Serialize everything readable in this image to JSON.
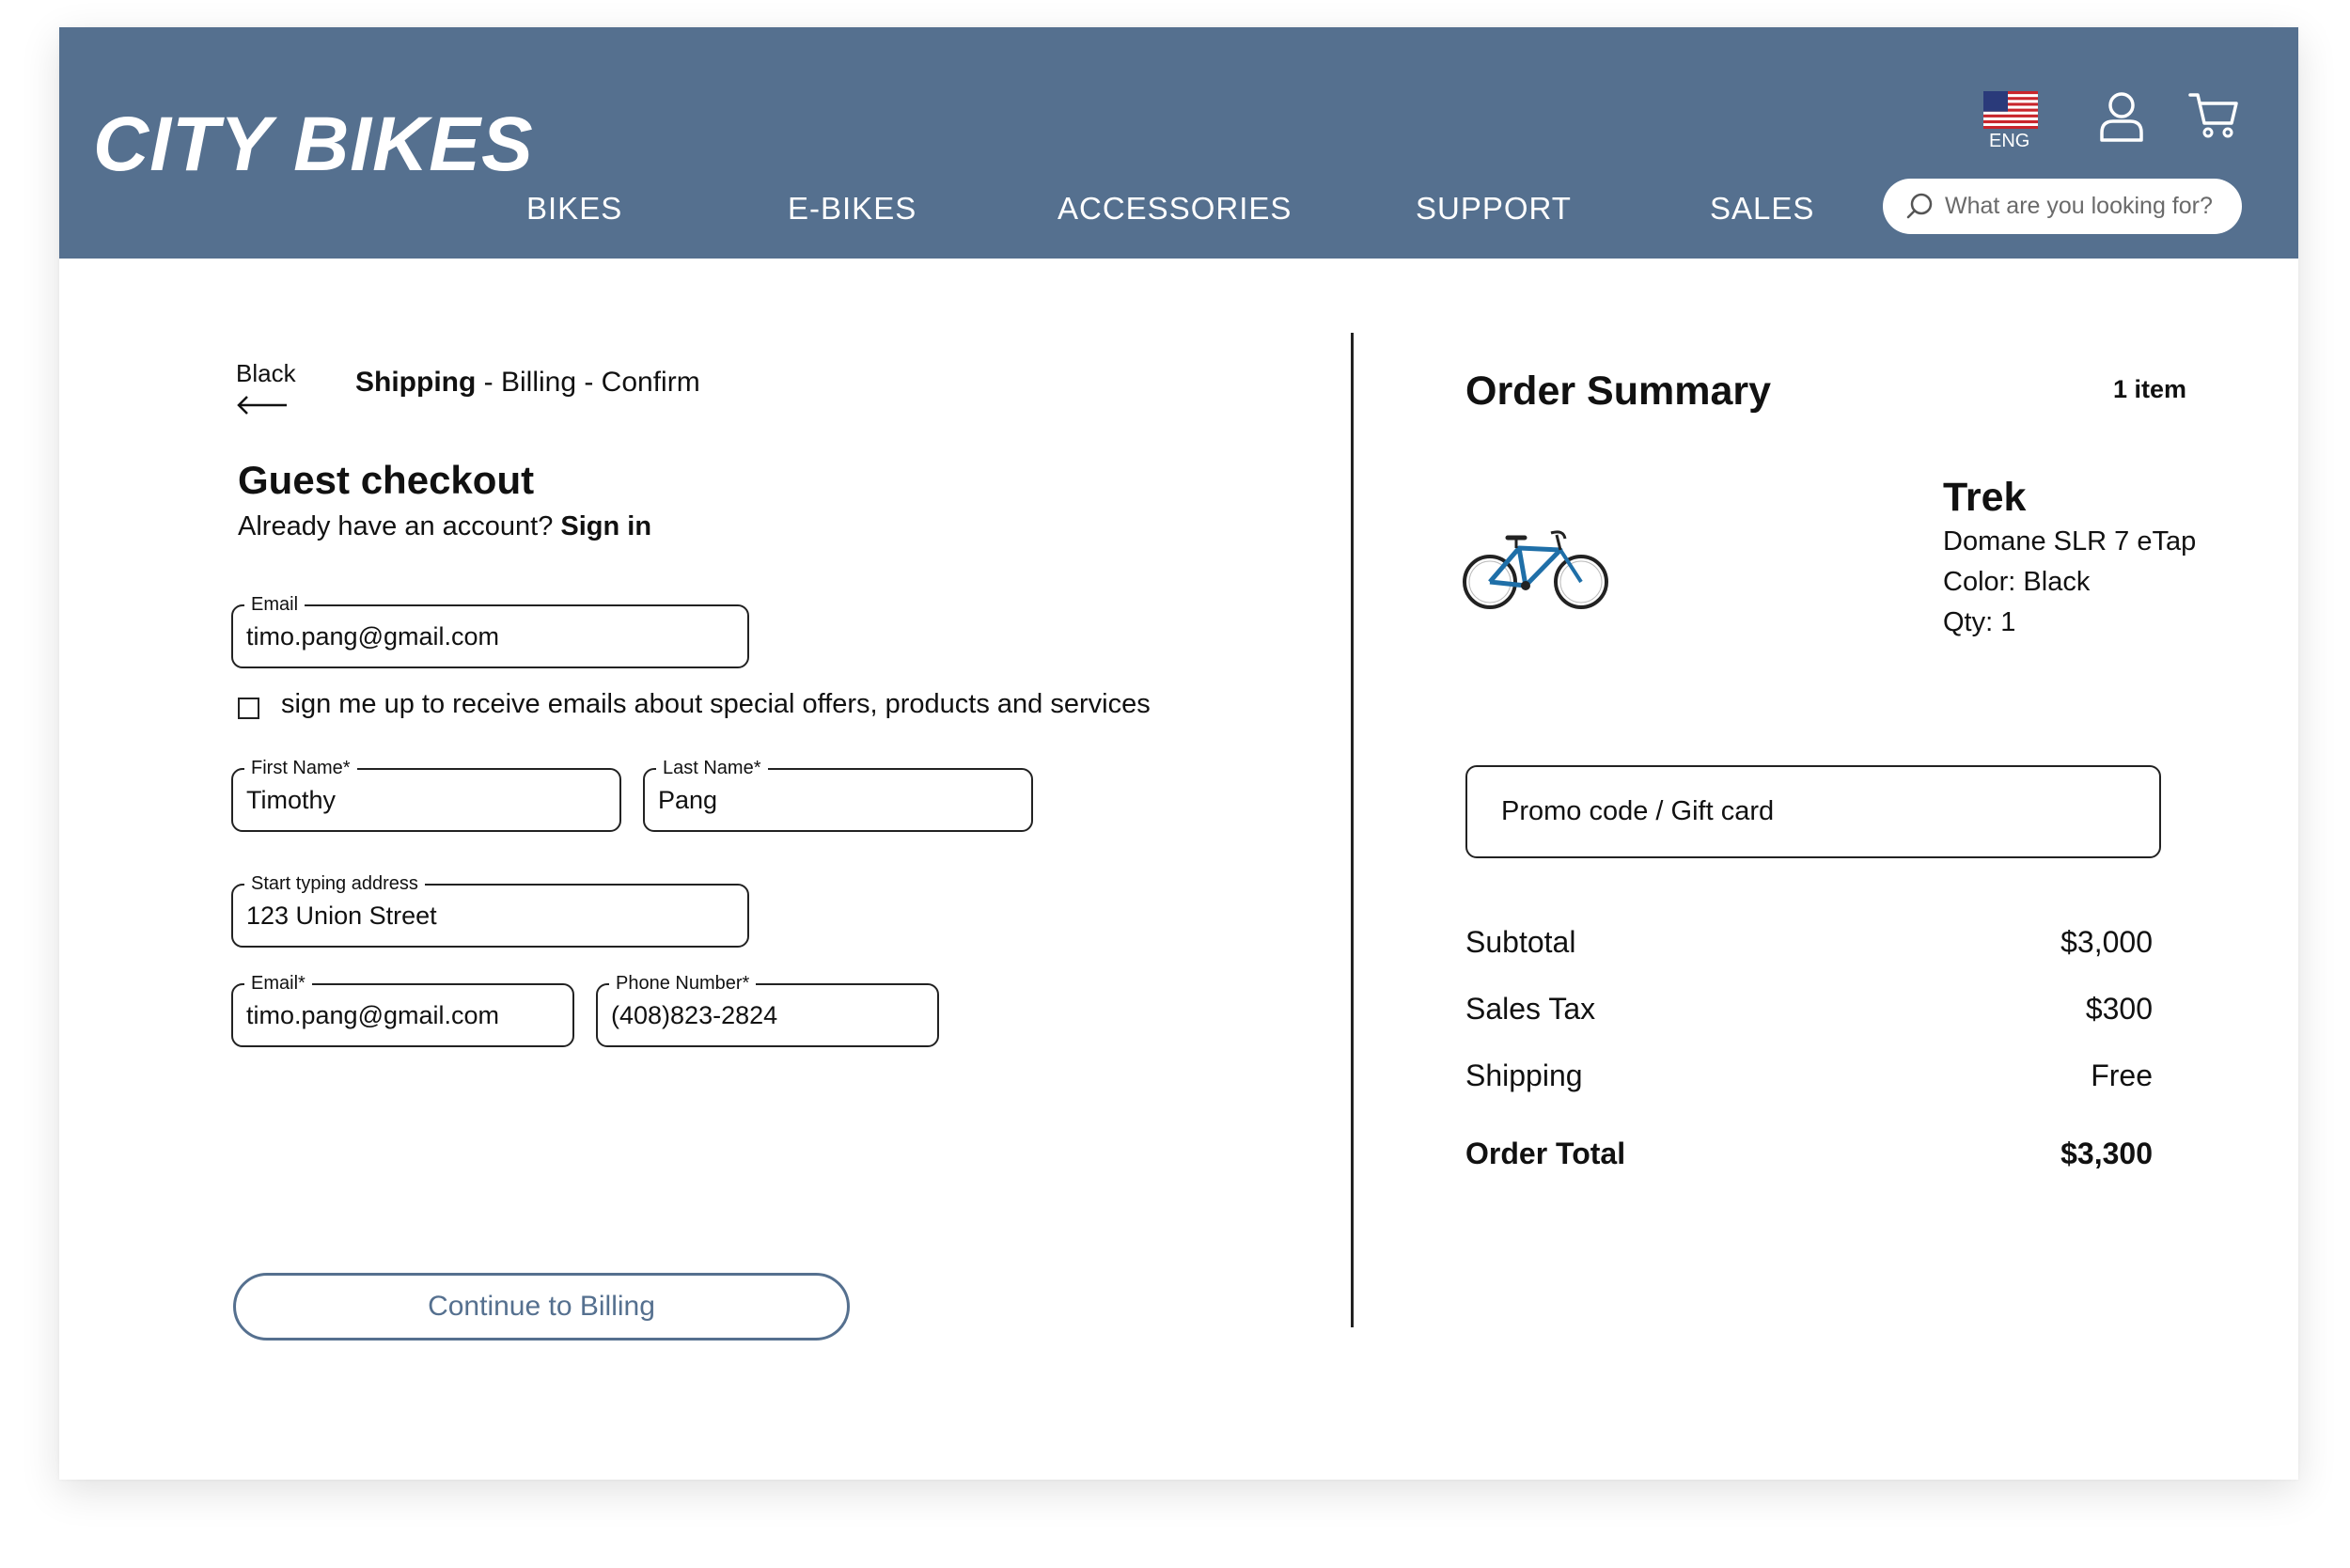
{
  "header": {
    "logo": "CITY BIKES",
    "nav": [
      "BIKES",
      "E-BIKES",
      "ACCESSORIES",
      "SUPPORT",
      "SALES"
    ],
    "language": "ENG",
    "search_placeholder": "What are you looking for?"
  },
  "checkout": {
    "back_label": "Black",
    "steps": {
      "current": "Shipping",
      "rest": " - Billing - Confirm"
    },
    "title": "Guest checkout",
    "subtitle": "Already have an account? ",
    "sign_in": "Sign in",
    "email": {
      "label": "Email",
      "value": "timo.pang@gmail.com"
    },
    "optin_label": "sign me up to receive emails about special offers, products and services",
    "optin_checked": false,
    "first_name": {
      "label": "First Name*",
      "value": "Timothy"
    },
    "last_name": {
      "label": "Last Name*",
      "value": "Pang"
    },
    "address": {
      "label": "Start typing address",
      "value": "123 Union Street"
    },
    "email2": {
      "label": "Email*",
      "value": "timo.pang@gmail.com"
    },
    "phone": {
      "label": "Phone  Number*",
      "value": "(408)823-2824"
    },
    "continue_label": "Continue to Billing"
  },
  "summary": {
    "title": "Order Summary",
    "item_count": "1 item",
    "product": {
      "brand": "Trek",
      "model": "Domane SLR 7 eTap",
      "color": "Color: Black",
      "qty": "Qty: 1"
    },
    "promo_placeholder": "Promo code / Gift card",
    "subtotal": {
      "label": "Subtotal",
      "value": "$3,000"
    },
    "tax": {
      "label": "Sales Tax",
      "value": "$300"
    },
    "shipping": {
      "label": "Shipping",
      "value": "Free"
    },
    "total": {
      "label": "Order Total",
      "value": "$3,300"
    }
  },
  "colors": {
    "header": "#55708f",
    "accent": "#55708f",
    "text": "#111111"
  }
}
